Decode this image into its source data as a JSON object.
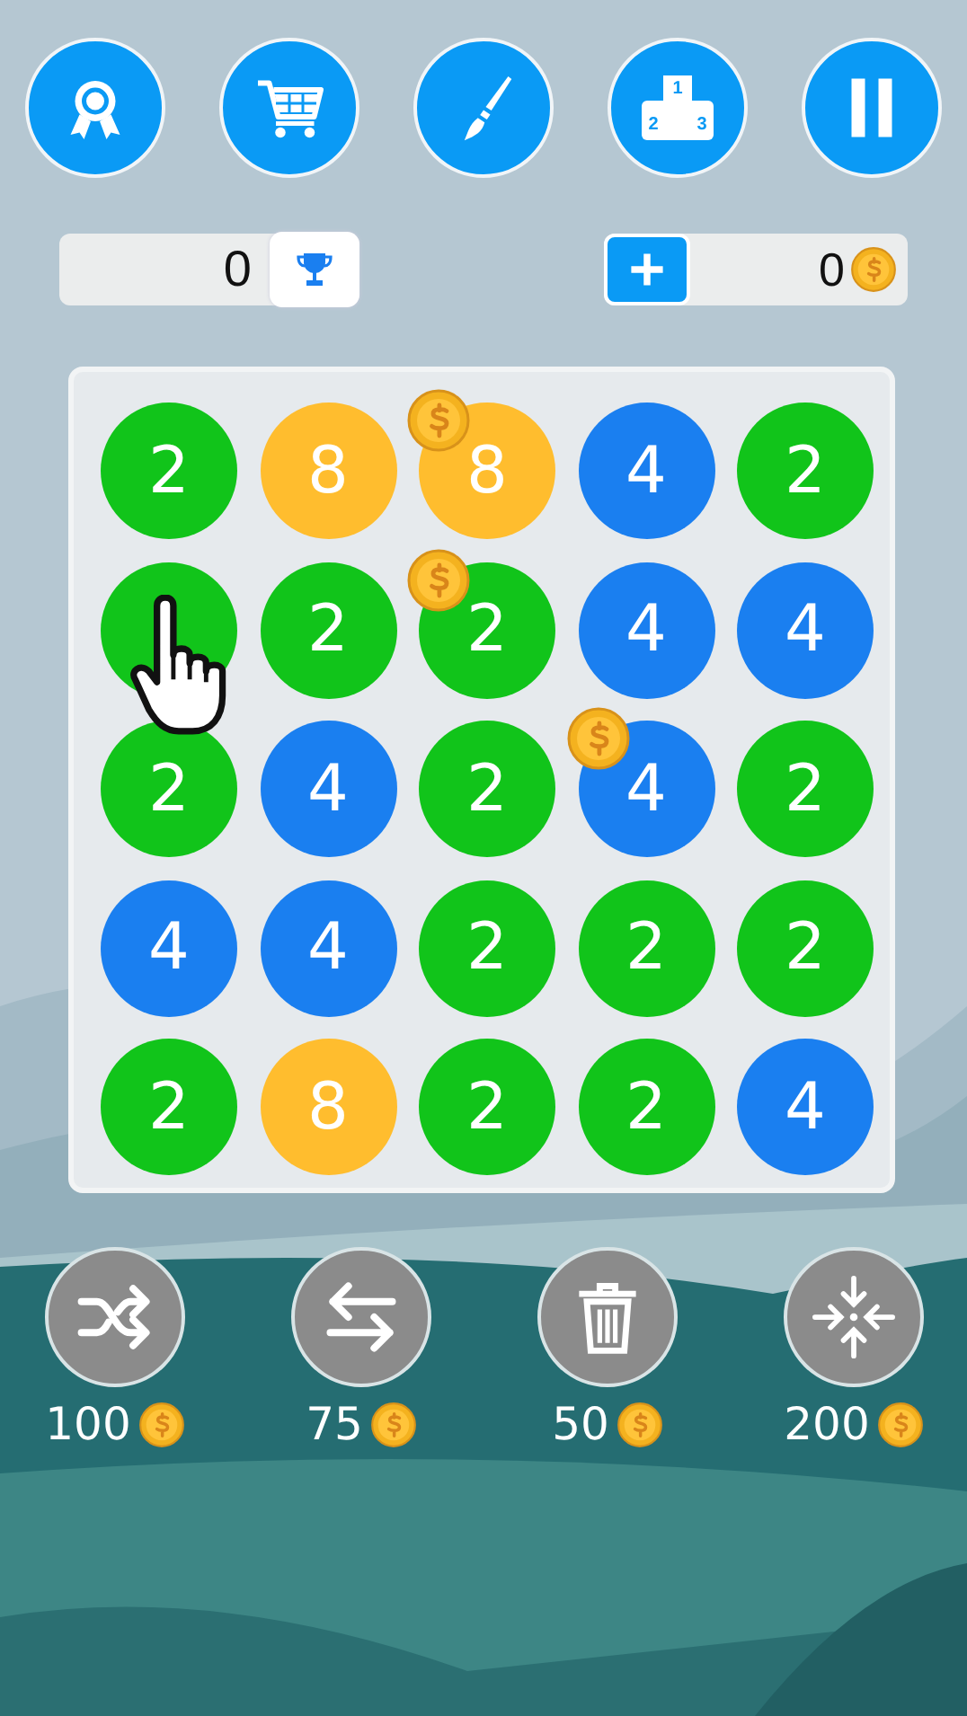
{
  "top_bar": {
    "podium_ranks": [
      "1",
      "2",
      "3"
    ]
  },
  "best_score": {
    "value": "0"
  },
  "coins": {
    "amount": "0"
  },
  "board": {
    "tiles": [
      {
        "value": "2",
        "color": "#11c41a",
        "coin": false
      },
      {
        "value": "8",
        "color": "#ffbd2e",
        "coin": false
      },
      {
        "value": "8",
        "color": "#ffbd2e",
        "coin": true
      },
      {
        "value": "4",
        "color": "#1a7ff0",
        "coin": false
      },
      {
        "value": "2",
        "color": "#11c41a",
        "coin": false
      },
      {
        "color": "#11c41a",
        "coin": false
      },
      {
        "value": "2",
        "color": "#11c41a",
        "coin": false
      },
      {
        "value": "2",
        "color": "#11c41a",
        "coin": true
      },
      {
        "value": "4",
        "color": "#1a7ff0",
        "coin": false
      },
      {
        "value": "4",
        "color": "#1a7ff0",
        "coin": false
      },
      {
        "value": "2",
        "color": "#11c41a",
        "coin": false
      },
      {
        "value": "4",
        "color": "#1a7ff0",
        "coin": false
      },
      {
        "value": "2",
        "color": "#11c41a",
        "coin": false
      },
      {
        "value": "4",
        "color": "#1a7ff0",
        "coin": true
      },
      {
        "value": "2",
        "color": "#11c41a",
        "coin": false
      },
      {
        "value": "4",
        "color": "#1a7ff0",
        "coin": false
      },
      {
        "value": "4",
        "color": "#1a7ff0",
        "coin": false
      },
      {
        "value": "2",
        "color": "#11c41a",
        "coin": false
      },
      {
        "value": "2",
        "color": "#11c41a",
        "coin": false
      },
      {
        "value": "2",
        "color": "#11c41a",
        "coin": false
      },
      {
        "value": "2",
        "color": "#11c41a",
        "coin": false
      },
      {
        "value": "8",
        "color": "#ffbd2e",
        "coin": false
      },
      {
        "value": "2",
        "color": "#11c41a",
        "coin": false
      },
      {
        "value": "2",
        "color": "#11c41a",
        "coin": false
      },
      {
        "value": "4",
        "color": "#1a7ff0",
        "coin": false
      }
    ]
  },
  "boosters": [
    {
      "price": "100"
    },
    {
      "price": "75"
    },
    {
      "price": "50"
    },
    {
      "price": "200"
    }
  ]
}
